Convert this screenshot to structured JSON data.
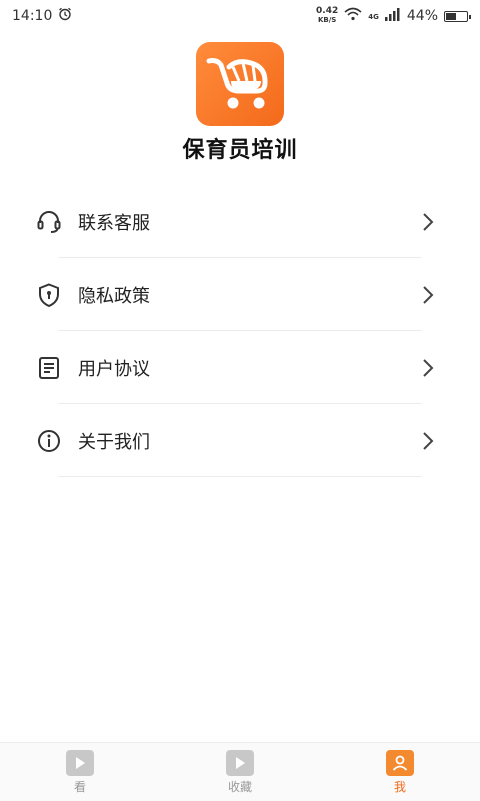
{
  "status_bar": {
    "time": "14:10",
    "net_speed_value": "0.42",
    "net_speed_unit": "KB/S",
    "network_label": "4G",
    "battery_percent": "44%",
    "battery_level": 0.44
  },
  "app": {
    "title": "保育员培训",
    "logo_icon": "shopping-cart-icon",
    "brand_color": "#f36a1a"
  },
  "menu": {
    "items": [
      {
        "label": "联系客服",
        "icon": "headset-icon"
      },
      {
        "label": "隐私政策",
        "icon": "shield-lock-icon"
      },
      {
        "label": "用户协议",
        "icon": "document-icon"
      },
      {
        "label": "关于我们",
        "icon": "info-icon"
      }
    ]
  },
  "tab_bar": {
    "tabs": [
      {
        "label": "看",
        "icon": "play-icon",
        "active": false
      },
      {
        "label": "收藏",
        "icon": "play-icon",
        "active": false
      },
      {
        "label": "我",
        "icon": "user-icon",
        "active": true
      }
    ]
  }
}
